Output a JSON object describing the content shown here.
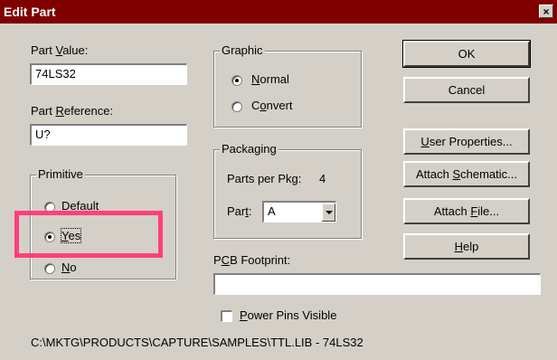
{
  "window": {
    "title": "Edit Part",
    "close_glyph": "×"
  },
  "part_value": {
    "label_pre": "Part ",
    "label_ul": "V",
    "label_post": "alue:",
    "value": "74LS32"
  },
  "part_reference": {
    "label_pre": "Part ",
    "label_ul": "R",
    "label_post": "eference:",
    "value": "U?"
  },
  "primitive": {
    "legend": "Primitive",
    "options": [
      {
        "pre": "",
        "ul": "D",
        "post": "efault",
        "checked": false
      },
      {
        "pre": "",
        "ul": "Y",
        "post": "es",
        "checked": true
      },
      {
        "pre": "",
        "ul": "N",
        "post": "o",
        "checked": false
      }
    ]
  },
  "graphic": {
    "legend": "Graphic",
    "options": [
      {
        "pre": "",
        "ul": "N",
        "post": "ormal",
        "checked": true
      },
      {
        "pre": "C",
        "ul": "o",
        "post": "nvert",
        "checked": false
      }
    ]
  },
  "packaging": {
    "legend": "Packaging",
    "parts_per_pkg_label": "Parts per Pkg:",
    "parts_per_pkg_value": "4",
    "part_label_pre": "Par",
    "part_label_ul": "t",
    "part_label_post": ":",
    "part_value": "A"
  },
  "pcb_footprint": {
    "label_pre": "P",
    "label_ul": "C",
    "label_post": "B Footprint:",
    "value": ""
  },
  "power_pins": {
    "label_pre": "",
    "label_ul": "P",
    "label_post": "ower Pins Visible",
    "checked": false
  },
  "buttons": {
    "ok": "OK",
    "cancel": "Cancel",
    "user_properties": {
      "pre": "",
      "ul": "U",
      "post": "ser Properties..."
    },
    "attach_schematic": {
      "pre": "Attach ",
      "ul": "S",
      "post": "chematic..."
    },
    "attach_file": {
      "pre": "Attach ",
      "ul": "F",
      "post": "ile..."
    },
    "help": {
      "pre": "",
      "ul": "H",
      "post": "elp"
    }
  },
  "status_path": "C:\\MKTG\\PRODUCTS\\CAPTURE\\SAMPLES\\TTL.LIB - 74LS32",
  "colors": {
    "titlebar": "#800000",
    "dialog": "#d4d0c8",
    "highlight": "#ff3f7e"
  }
}
